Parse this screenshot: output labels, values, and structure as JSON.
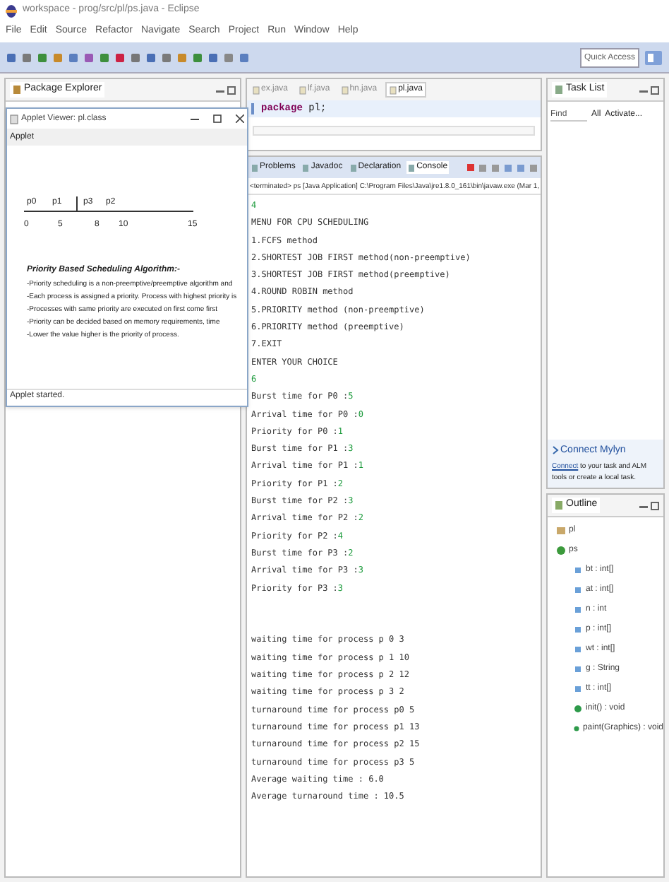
{
  "window": {
    "title": "workspace - prog/src/pl/ps.java - Eclipse"
  },
  "menu": [
    "File",
    "Edit",
    "Source",
    "Refactor",
    "Navigate",
    "Search",
    "Project",
    "Run",
    "Window",
    "Help"
  ],
  "quick_access": {
    "placeholder": "Quick Access"
  },
  "package_explorer": {
    "title": "Package Explorer"
  },
  "applet": {
    "title": "Applet Viewer: pl.class",
    "menu": "Applet",
    "gantt_labels": [
      "p0",
      "p1",
      "p3",
      "p2"
    ],
    "gantt_ticks": [
      "0",
      "5",
      "8",
      "10",
      "15"
    ],
    "heading": "Priority Based Scheduling Algorithm:-",
    "lines": [
      "-Priority scheduling is a non-preemptive/preemptive algorithm and",
      "-Each process is assigned a priority. Process with highest priority is",
      "-Processes with same priority are executed on first come first",
      "-Priority can be decided based on memory requirements, time",
      "-Lower the value higher is the priority of process."
    ],
    "status": "Applet started."
  },
  "editor": {
    "tabs": [
      {
        "label": "ex.java",
        "selected": false
      },
      {
        "label": "lf.java",
        "selected": false
      },
      {
        "label": "hn.java",
        "selected": false
      },
      {
        "label": "pl.java",
        "selected": true
      }
    ],
    "code": [
      {
        "keyword": "package",
        "text": " pl;"
      }
    ]
  },
  "console": {
    "tabs": [
      {
        "label": "Problems",
        "selected": false
      },
      {
        "label": "Javadoc",
        "selected": false
      },
      {
        "label": "Declaration",
        "selected": false
      },
      {
        "label": "Console",
        "selected": true
      }
    ],
    "header": "<terminated> ps [Java Application] C:\\Program Files\\Java\\jre1.8.0_161\\bin\\javaw.exe (Mar 1,",
    "lines": [
      {
        "input": "4"
      },
      {
        "text": "MENU FOR CPU SCHEDULING"
      },
      {
        "text": "1.FCFS method"
      },
      {
        "text": "2.SHORTEST JOB FIRST method(non-preemptive)"
      },
      {
        "text": "3.SHORTEST JOB FIRST method(preemptive)"
      },
      {
        "text": "4.ROUND ROBIN method"
      },
      {
        "text": "5.PRIORITY method (non-preemptive)"
      },
      {
        "text": "6.PRIORITY method (preemptive)"
      },
      {
        "text": "7.EXIT"
      },
      {
        "text": "ENTER YOUR CHOICE"
      },
      {
        "input": "6"
      },
      {
        "text": "Burst time for P0 :",
        "input": "5"
      },
      {
        "text": "Arrival time for P0 :",
        "input": "0"
      },
      {
        "text": "Priority for P0 :",
        "input": "1"
      },
      {
        "text": "Burst time for P1 :",
        "input": "3"
      },
      {
        "text": "Arrival time for P1 :",
        "input": "1"
      },
      {
        "text": "Priority for P1 :",
        "input": "2"
      },
      {
        "text": "Burst time for P2 :",
        "input": "3"
      },
      {
        "text": "Arrival time for P2 :",
        "input": "2"
      },
      {
        "text": "Priority for P2 :",
        "input": "4"
      },
      {
        "text": "Burst time for P3 :",
        "input": "2"
      },
      {
        "text": "Arrival time for P3 :",
        "input": "3"
      },
      {
        "text": "Priority for P3 :",
        "input": "3"
      },
      {
        "text": "waiting time for process p 0  3",
        "gap_before": true
      },
      {
        "text": "waiting time for process p 1  10"
      },
      {
        "text": "waiting time for process p 2  12"
      },
      {
        "text": "waiting time for process p 3  2"
      },
      {
        "text": "turnaround time for process p0  5"
      },
      {
        "text": "turnaround time for process p1  13"
      },
      {
        "text": "turnaround time for process p2  15"
      },
      {
        "text": "turnaround time for process p3  5"
      },
      {
        "text": "Average waiting time : 6.0"
      },
      {
        "text": "Average turnaround time : 10.5"
      }
    ]
  },
  "task_list": {
    "title": "Task List",
    "find": {
      "placeholder": "Find"
    },
    "filter": "All",
    "activate": "Activate..."
  },
  "mylyn": {
    "title": "Connect Mylyn",
    "link": "Connect",
    "text": " to your task and ALM tools or create a local task."
  },
  "outline": {
    "title": "Outline",
    "items": [
      {
        "kind": "package",
        "label": "pl"
      },
      {
        "kind": "class",
        "label": "ps",
        "children": [
          {
            "kind": "field",
            "label": "bt : int[]"
          },
          {
            "kind": "field",
            "label": "at : int[]"
          },
          {
            "kind": "field",
            "label": "n : int"
          },
          {
            "kind": "field",
            "label": "p : int[]"
          },
          {
            "kind": "field",
            "label": "wt : int[]"
          },
          {
            "kind": "field",
            "label": "g : String"
          },
          {
            "kind": "field",
            "label": "tt : int[]"
          },
          {
            "kind": "method",
            "label": "init() : void"
          },
          {
            "kind": "method",
            "label": "paint(Graphics) : void"
          }
        ]
      }
    ]
  }
}
